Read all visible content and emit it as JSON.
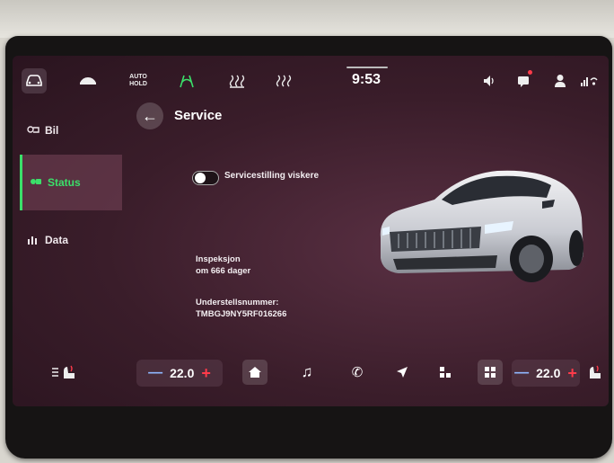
{
  "topbar": {
    "autohold_label_line1": "AUTO",
    "autohold_label_line2": "HOLD",
    "clock": "9:53"
  },
  "sidebar": {
    "items": [
      {
        "label": "Bil",
        "icon": "car-settings-icon"
      },
      {
        "label": "Status",
        "icon": "car-status-icon",
        "active": true
      },
      {
        "label": "Data",
        "icon": "bar-chart-icon"
      }
    ]
  },
  "main": {
    "title": "Service",
    "service_toggle_label": "Servicestilling viskere",
    "inspection_label": "Inspeksjon",
    "inspection_value": "om 666 dager",
    "vin_label": "Understellsnummer:",
    "vin_value": "TMBGJ9NY5RF016266"
  },
  "climate": {
    "left_temp": "22.0",
    "right_temp": "22.0"
  },
  "colors": {
    "accent": "#3be06a",
    "background": "#3a1d2a",
    "plus": "#ff3b4a",
    "minus": "#8fb7ff"
  }
}
